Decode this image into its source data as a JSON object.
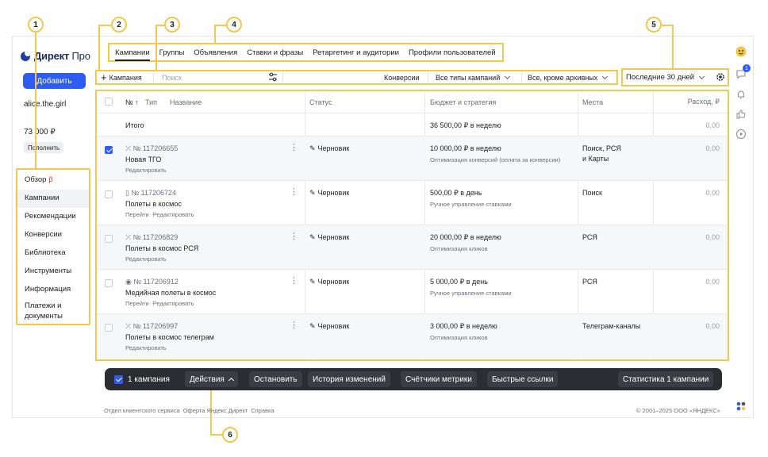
{
  "app": {
    "logo_text_bold": "Директ",
    "logo_text_light": "Про",
    "add_button": "Добавить",
    "user_login": "alice.the.girl",
    "balance": "73 000 ₽",
    "topup_button": "Пополнить"
  },
  "sidebar": {
    "items": [
      {
        "label": "Обзор",
        "mark": "β"
      },
      {
        "label": "Кампании"
      },
      {
        "label": "Рекомендации"
      },
      {
        "label": "Конверсии"
      },
      {
        "label": "Библиотека"
      },
      {
        "label": "Инструменты"
      },
      {
        "label": "Информация"
      },
      {
        "label": "Платежи и документы"
      }
    ]
  },
  "callouts": [
    "1",
    "2",
    "3",
    "4",
    "5",
    "6"
  ],
  "tabs": [
    "Кампании",
    "Группы",
    "Объявления",
    "Ставки и фразы",
    "Ретаргетинг и аудитории",
    "Профили пользователей"
  ],
  "filters": {
    "add_campaign": "Кампания",
    "search_placeholder": "Поиск",
    "conversions": "Конверсии",
    "campaign_types": "Все типы кампаний",
    "archive": "Все, кроме архивных",
    "period": "Последние 30 дней"
  },
  "table": {
    "headers": {
      "num": "№",
      "sort": "↑",
      "type": "Тип",
      "name": "Название",
      "status": "Статус",
      "budget": "Бюджет и стратегия",
      "places": "Места",
      "spend": "Расход, ₽"
    },
    "total": {
      "label": "Итого",
      "budget": "36 500,00 ₽ в неделю",
      "spend": "0,00"
    },
    "rows": [
      {
        "id": "№ 117206655",
        "type_icon": "⤫",
        "name": "Новая ТГО",
        "links": [
          "Редактировать"
        ],
        "status": "Черновик",
        "budget": "10 000,00 ₽ в неделю",
        "strategy": "Оптимизация конверсий (оплата за конверсии)",
        "places": "Поиск, РСЯ",
        "places2": "и Карты",
        "spend": "0,00",
        "checked": true
      },
      {
        "id": "№ 117206724",
        "type_icon": "▯",
        "name": "Полеты в космос",
        "links": [
          "Перейти",
          "Редактировать"
        ],
        "status": "Черновик",
        "budget": "500,00 ₽ в день",
        "strategy": "Ручное управление ставками",
        "places": "Поиск",
        "places2": "",
        "spend": "0,00",
        "checked": false
      },
      {
        "id": "№ 117206829",
        "type_icon": "⤫",
        "name": "Полеты в космос РСЯ",
        "links": [
          "Редактировать"
        ],
        "status": "Черновик",
        "budget": "20 000,00 ₽ в неделю",
        "strategy": "Оптимизация кликов",
        "places": "РСЯ",
        "places2": "",
        "spend": "0,00",
        "checked": false
      },
      {
        "id": "№ 117206912",
        "type_icon": "◉",
        "name": "Медийная полеты в космос",
        "links": [
          "Перейти",
          "Редактировать"
        ],
        "status": "Черновик",
        "budget": "5 000,00 ₽ в день",
        "strategy": "Ручное управление ставками",
        "places": "РСЯ",
        "places2": "",
        "spend": "0,00",
        "checked": false
      },
      {
        "id": "№ 117206997",
        "type_icon": "⤫",
        "name": "Полеты в космос телеграм",
        "links": [
          "Редактировать"
        ],
        "status": "Черновик",
        "budget": "3 000,00 ₽ в неделю",
        "strategy": "Оптимизация кликов",
        "places": "Телеграм-каналы",
        "places2": "",
        "spend": "0,00",
        "checked": false
      }
    ]
  },
  "action_bar": {
    "selected": "1 кампания",
    "actions": "Действия",
    "stop": "Остановить",
    "history": "История изменений",
    "counters": "Счётчики метрики",
    "quick_links": "Быстрые ссылки",
    "stats": "Статистика 1 кампании"
  },
  "footer": {
    "links": [
      "Отдел клиентского сервиса",
      "Оферта Яндекс Директ",
      "Справка"
    ],
    "copyright": "© 2001–2025 ООО «ЯНДЕКС»"
  },
  "rail": {
    "badge": "1"
  },
  "colors": {
    "accent": "#2e5bf0",
    "highlight": "#f2c94c",
    "action_bar": "#2c2d33"
  }
}
